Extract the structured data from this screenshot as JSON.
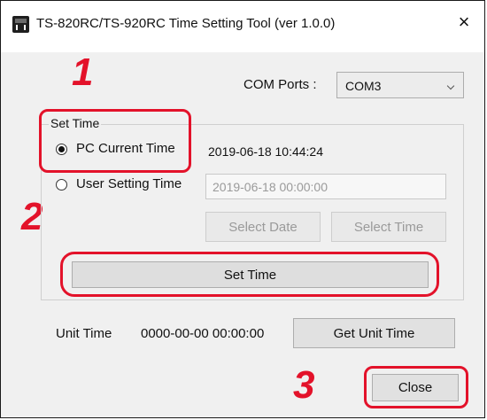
{
  "window": {
    "title": "TS-820RC/TS-920RC Time Setting Tool (ver 1.0.0)",
    "close_glyph": "×"
  },
  "annotations": {
    "step1": "1",
    "step2": "2",
    "step3": "3",
    "highlight_color": "#e3122a"
  },
  "com_ports": {
    "label": "COM Ports :",
    "selected": "COM3"
  },
  "set_time_group": {
    "title": "Set Time",
    "pc_current_time": {
      "label": "PC Current Time",
      "value": "2019-06-18 10:44:24",
      "checked": true
    },
    "user_setting_time": {
      "label": "User Setting Time",
      "value": "2019-06-18 00:00:00",
      "checked": false
    },
    "select_date_label": "Select Date",
    "select_time_label": "Select Time",
    "set_time_label": "Set Time"
  },
  "unit_time": {
    "label": "Unit Time",
    "value": "0000-00-00 00:00:00",
    "get_label": "Get Unit Time"
  },
  "close_label": "Close"
}
